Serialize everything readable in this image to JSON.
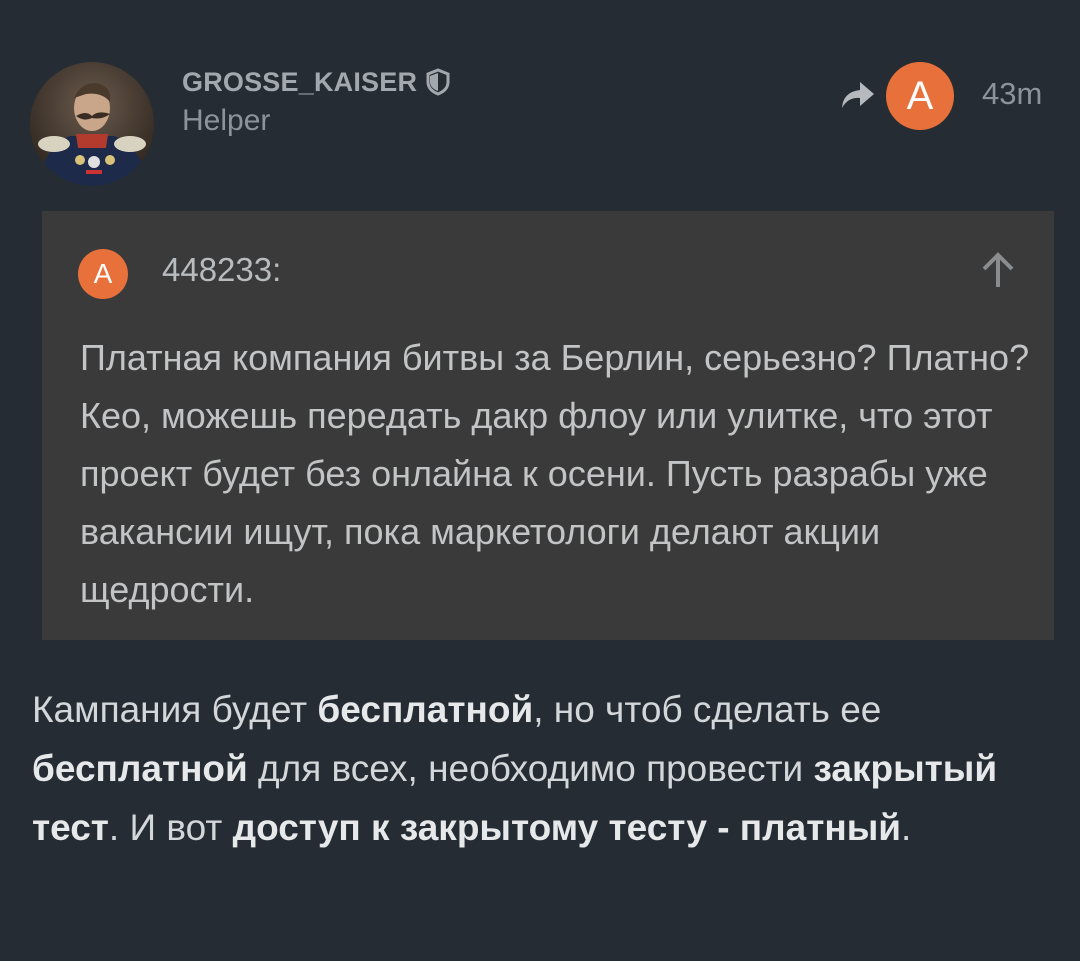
{
  "post": {
    "username": "GROSSE_KAISER",
    "role": "Helper",
    "header_badge": "A",
    "time": "43m",
    "icons": {
      "moderator": "shield-icon",
      "reply": "reply-arrow-icon",
      "scroll_to_quote": "arrow-up-icon"
    },
    "colors": {
      "badge": "#e8703a",
      "background": "#252c33",
      "quote_background": "#3a3a3a"
    }
  },
  "quote": {
    "badge": "A",
    "author": "448233:",
    "text": "Платная компания битвы за Берлин, серьезно? Платно? Кео, можешь передать дакр флоу или улитке, что этот проект будет без онлайна к осени. Пусть разрабы уже вакансии ищут, пока маркетологи делают акции щедрости."
  },
  "body": {
    "t1": "Кампания будет ",
    "b1": "бесплатной",
    "t2": ", но чтоб сделать ее ",
    "b2": "бесплатной",
    "t3": " для всех, необходимо провести ",
    "b3": "закрытый тест",
    "t4": ". И вот ",
    "b4": "доступ к закрытому тесту - платный",
    "t5": "."
  }
}
